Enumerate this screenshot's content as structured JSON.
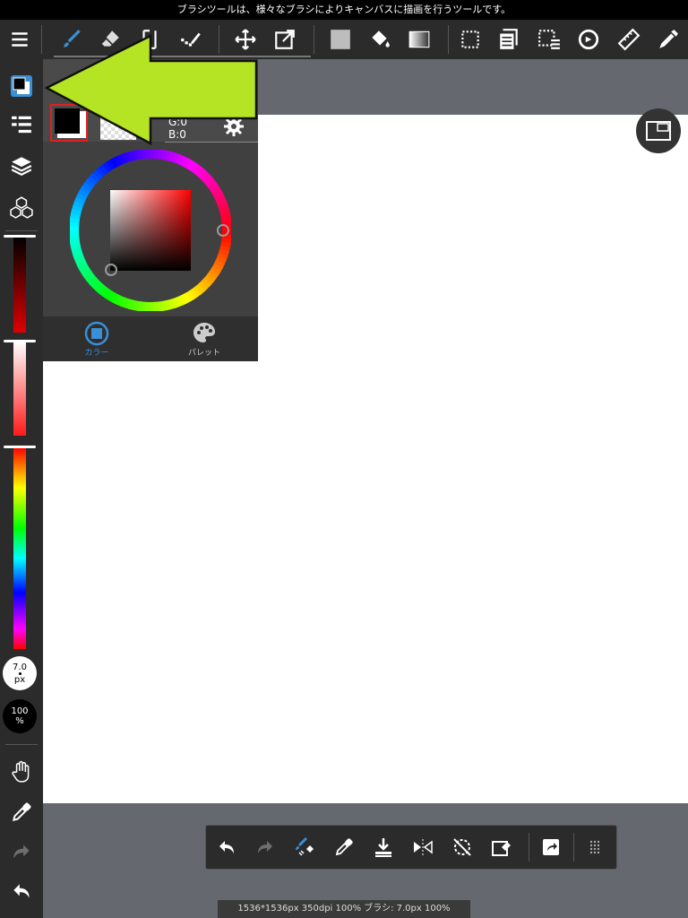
{
  "status_banner": "ブラシツールは、様々なブラシによりキャンバスに描画を行うツールです。",
  "color_panel": {
    "rgb_g": "G:0",
    "rgb_b": "B:0",
    "tabs": [
      {
        "label": "カラー",
        "active": true
      },
      {
        "label": "パレット",
        "active": false
      }
    ],
    "selected_color": "#000000"
  },
  "left_bar": {
    "brush_size": "7.0",
    "brush_size_unit": "px",
    "opacity": "100",
    "opacity_unit": "%"
  },
  "doc_info": "1536*1536px 350dpi 100% ブラシ: 7.0px 100%",
  "colors": {
    "accent": "#3a8fd6",
    "arrow": "#b5e424",
    "toolbar_bg": "#2b2b2b",
    "workspace_bg": "#65686e"
  },
  "icons": {
    "top_toolbar": [
      "menu-icon",
      "brush-icon",
      "eraser-icon",
      "select-rect-icon",
      "dot-brush-icon",
      "move-icon",
      "transform-icon",
      "fill-color-icon",
      "bucket-icon",
      "gradient-icon",
      "select-icon",
      "layer-panel-icon",
      "select-menu-icon",
      "rotate-icon",
      "ruler-icon",
      "pen-icon"
    ],
    "bottom_toolbar": [
      "undo-icon",
      "redo-icon",
      "brush-eraser-toggle-icon",
      "eyedropper-icon",
      "save-icon",
      "flip-icon",
      "rotate-off-icon",
      "clear-icon",
      "share-icon",
      "more-icon"
    ]
  }
}
